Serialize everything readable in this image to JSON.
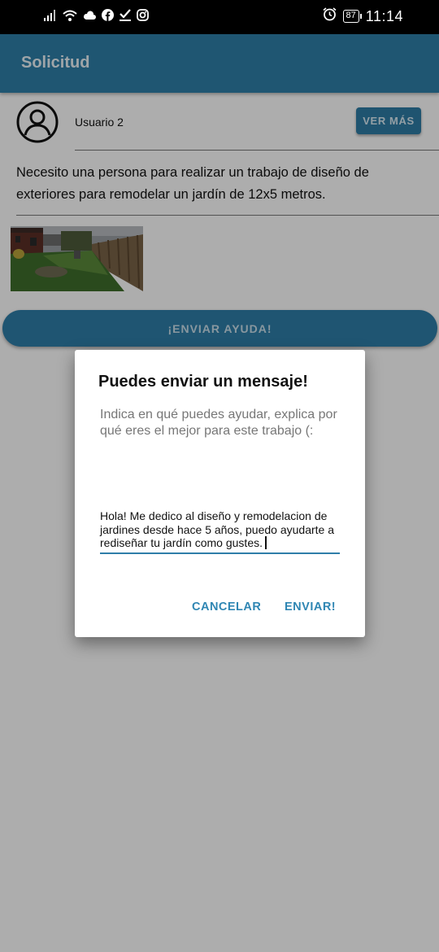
{
  "status_bar": {
    "time": "11:14",
    "battery": "87",
    "left_icons": [
      "signal-icon",
      "wifi-icon",
      "cloud-icon",
      "facebook-icon",
      "check-download-icon",
      "instagram-icon"
    ],
    "right_icons": [
      "alarm-icon",
      "battery-icon"
    ]
  },
  "app_bar": {
    "title": "Solicitud"
  },
  "request": {
    "user_name": "Usuario 2",
    "see_more_label": "VER MÁS",
    "description": "Necesito una persona para realizar un trabajo de diseño de exteriores para remodelar un jardín de 12x5 metros.",
    "photo_icon": "garden-photo"
  },
  "send_help_label": "¡ENVIAR AYUDA!",
  "dialog": {
    "title": "Puedes enviar un mensaje!",
    "hint": "Indica en qué puedes ayudar, explica por qué eres el mejor para este trabajo (:",
    "input_value": "Hola! Me dedico al diseño y remodelacion de jardines desde hace 5 años, puedo ayudarte a rediseñar tu jardín como gustes.",
    "cancel_label": "CANCELAR",
    "send_label": "ENVIAR!"
  },
  "colors": {
    "primary": "#2f7fa9",
    "status_bar": "#000000",
    "accent_text": "#2f86b3"
  }
}
